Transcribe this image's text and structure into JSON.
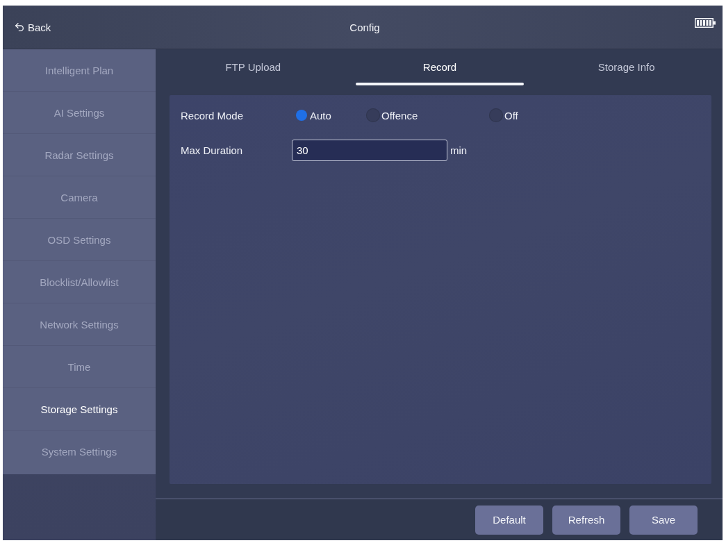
{
  "header": {
    "back": "Back",
    "title": "Config"
  },
  "sidebar": {
    "items": [
      {
        "label": "Intelligent Plan",
        "selected": false
      },
      {
        "label": "AI Settings",
        "selected": false
      },
      {
        "label": "Radar Settings",
        "selected": false
      },
      {
        "label": "Camera",
        "selected": false
      },
      {
        "label": "OSD Settings",
        "selected": false
      },
      {
        "label": "Blocklist/Allowlist",
        "selected": false
      },
      {
        "label": "Network Settings",
        "selected": false
      },
      {
        "label": "Time",
        "selected": false
      },
      {
        "label": "Storage Settings",
        "selected": true
      },
      {
        "label": "System Settings",
        "selected": false
      }
    ]
  },
  "tabs": [
    {
      "label": "FTP Upload",
      "selected": false
    },
    {
      "label": "Record",
      "selected": true
    },
    {
      "label": "Storage Info",
      "selected": false
    }
  ],
  "form": {
    "record_mode": {
      "label": "Record Mode",
      "options": [
        {
          "label": "Auto",
          "selected": true
        },
        {
          "label": "Offence",
          "selected": false
        },
        {
          "label": "Off",
          "selected": false
        }
      ]
    },
    "max_duration": {
      "label": "Max Duration",
      "value": "30",
      "unit": "min"
    }
  },
  "buttons": [
    "Default",
    "Refresh",
    "Save"
  ]
}
